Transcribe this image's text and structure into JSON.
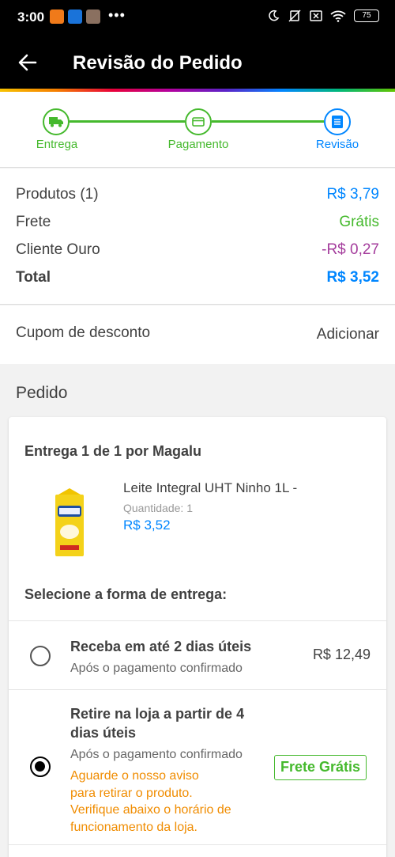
{
  "status_bar": {
    "time": "3:00",
    "battery": "75"
  },
  "header": {
    "title": "Revisão do Pedido"
  },
  "stepper": {
    "steps": [
      {
        "label": "Entrega"
      },
      {
        "label": "Pagamento"
      },
      {
        "label": "Revisão"
      }
    ]
  },
  "summary": {
    "rows": [
      {
        "label": "Produtos (1)",
        "value": "R$ 3,79"
      },
      {
        "label": "Frete",
        "value": "Grátis"
      },
      {
        "label": "Cliente Ouro",
        "value": "-R$ 0,27"
      },
      {
        "label": "Total",
        "value": "R$ 3,52"
      }
    ]
  },
  "coupon": {
    "label": "Cupom de desconto",
    "action": "Adicionar"
  },
  "order": {
    "section_title": "Pedido",
    "delivery_heading": "Entrega 1 de 1 por Magalu",
    "product": {
      "name": "Leite Integral UHT Ninho 1L -",
      "quantity_label": "Quantidade:",
      "quantity": "1",
      "price": "R$ 3,52"
    },
    "select_label": "Selecione a forma de entrega:",
    "options": [
      {
        "title": "Receba em até 2 dias úteis",
        "subtitle": "Após o pagamento confirmado",
        "price": "R$ 12,49",
        "selected": false
      },
      {
        "title_line1": "Retire na loja a partir de 4",
        "title_line2": "dias úteis",
        "subtitle": "Após o pagamento confirmado",
        "warning_lines": [
          "Aguarde o nosso aviso",
          "para retirar o produto.",
          "Verifique abaixo o horário de",
          "funcionamento da loja."
        ],
        "badge": "Frete Grátis",
        "selected": true
      }
    ]
  },
  "colors": {
    "accent_green": "#45b92d",
    "accent_blue": "#0086ff",
    "discount_purple": "#a43c9c",
    "warning_orange": "#f08c00"
  }
}
